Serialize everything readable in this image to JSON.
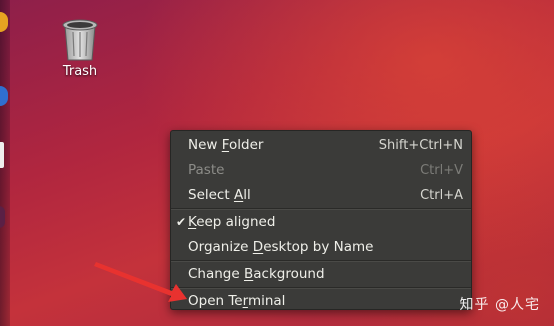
{
  "desktop": {
    "trash": {
      "label": "Trash",
      "icon": "trash-icon"
    }
  },
  "context_menu": {
    "items": [
      {
        "label_pre": "New ",
        "label_u": "F",
        "label_post": "older",
        "accelerator": "Shift+Ctrl+N",
        "enabled": true,
        "checked": false
      },
      {
        "label_pre": "Paste",
        "label_u": "",
        "label_post": "",
        "accelerator": "Ctrl+V",
        "enabled": false,
        "checked": false
      },
      {
        "label_pre": "Select ",
        "label_u": "A",
        "label_post": "ll",
        "accelerator": "Ctrl+A",
        "enabled": true,
        "checked": false
      },
      {
        "label_pre": "",
        "label_u": "K",
        "label_post": "eep aligned",
        "accelerator": "",
        "enabled": true,
        "checked": true
      },
      {
        "label_pre": "Organize ",
        "label_u": "D",
        "label_post": "esktop by Name",
        "accelerator": "",
        "enabled": true,
        "checked": false
      },
      {
        "label_pre": "Change ",
        "label_u": "B",
        "label_post": "ackground",
        "accelerator": "",
        "enabled": true,
        "checked": false
      },
      {
        "label_pre": "Open Te",
        "label_u": "r",
        "label_post": "minal",
        "accelerator": "",
        "enabled": true,
        "checked": false
      }
    ],
    "check_glyph": "✔"
  },
  "watermark": {
    "text": "知乎 @人宅"
  },
  "colors": {
    "menu_bg": "#3b3b39",
    "menu_text": "#efefe9",
    "menu_disabled": "#8c8c88",
    "arrow": "#e8322f"
  }
}
